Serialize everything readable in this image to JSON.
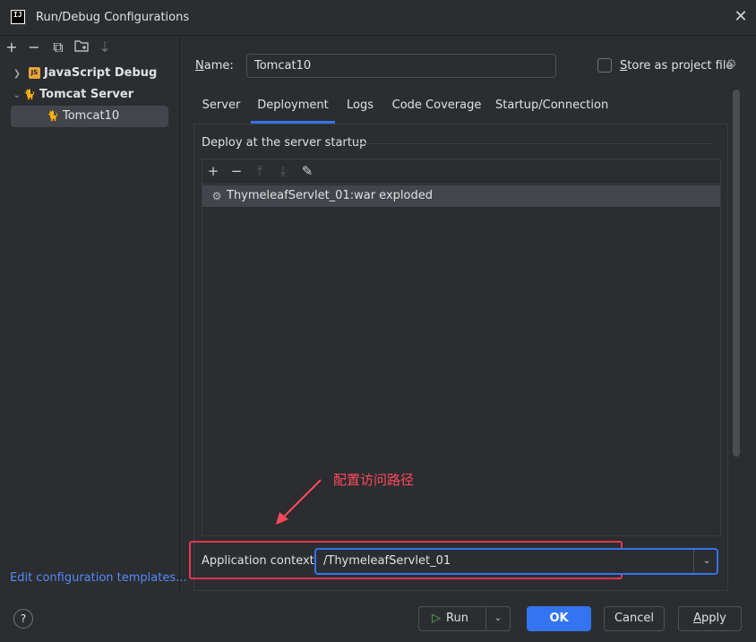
{
  "window": {
    "title": "Run/Debug Configurations",
    "logo_text": "IJ"
  },
  "left_toolbar": {
    "icons": [
      "add-icon",
      "remove-icon",
      "copy-icon",
      "new-folder-icon",
      "sort-icon"
    ]
  },
  "tree": {
    "items": [
      {
        "label": "JavaScript Debug",
        "expanded": false
      },
      {
        "label": "Tomcat Server",
        "expanded": true
      },
      {
        "label": "Tomcat10",
        "selected": true
      }
    ]
  },
  "edit_templates_link": "Edit configuration templates...",
  "name": {
    "label_first": "N",
    "label_rest": "ame:",
    "value": "Tomcat10"
  },
  "store_as_project_file": {
    "label_first": "S",
    "label_rest": "tore as project file",
    "checked": false
  },
  "tabs": [
    {
      "label": "Server",
      "active": false
    },
    {
      "label": "Deployment",
      "active": true
    },
    {
      "label": "Logs",
      "active": false
    },
    {
      "label": "Code Coverage",
      "active": false
    },
    {
      "label": "Startup/Connection",
      "active": false
    }
  ],
  "deployment": {
    "section_title": "Deploy at the server startup",
    "artifacts": [
      {
        "label": "ThymeleafServlet_01:war exploded"
      }
    ]
  },
  "annotation": "配置访问路径",
  "application_context": {
    "label": "Application context:",
    "value": "/ThymeleafServlet_01"
  },
  "buttons": {
    "help": "?",
    "run": "Run",
    "ok": "OK",
    "cancel": "Cancel",
    "apply": "Apply"
  },
  "colors": {
    "accent": "#3574f0",
    "link": "#548af7",
    "annotation": "#ff4a5c",
    "highlight_border": "#e8374e"
  }
}
